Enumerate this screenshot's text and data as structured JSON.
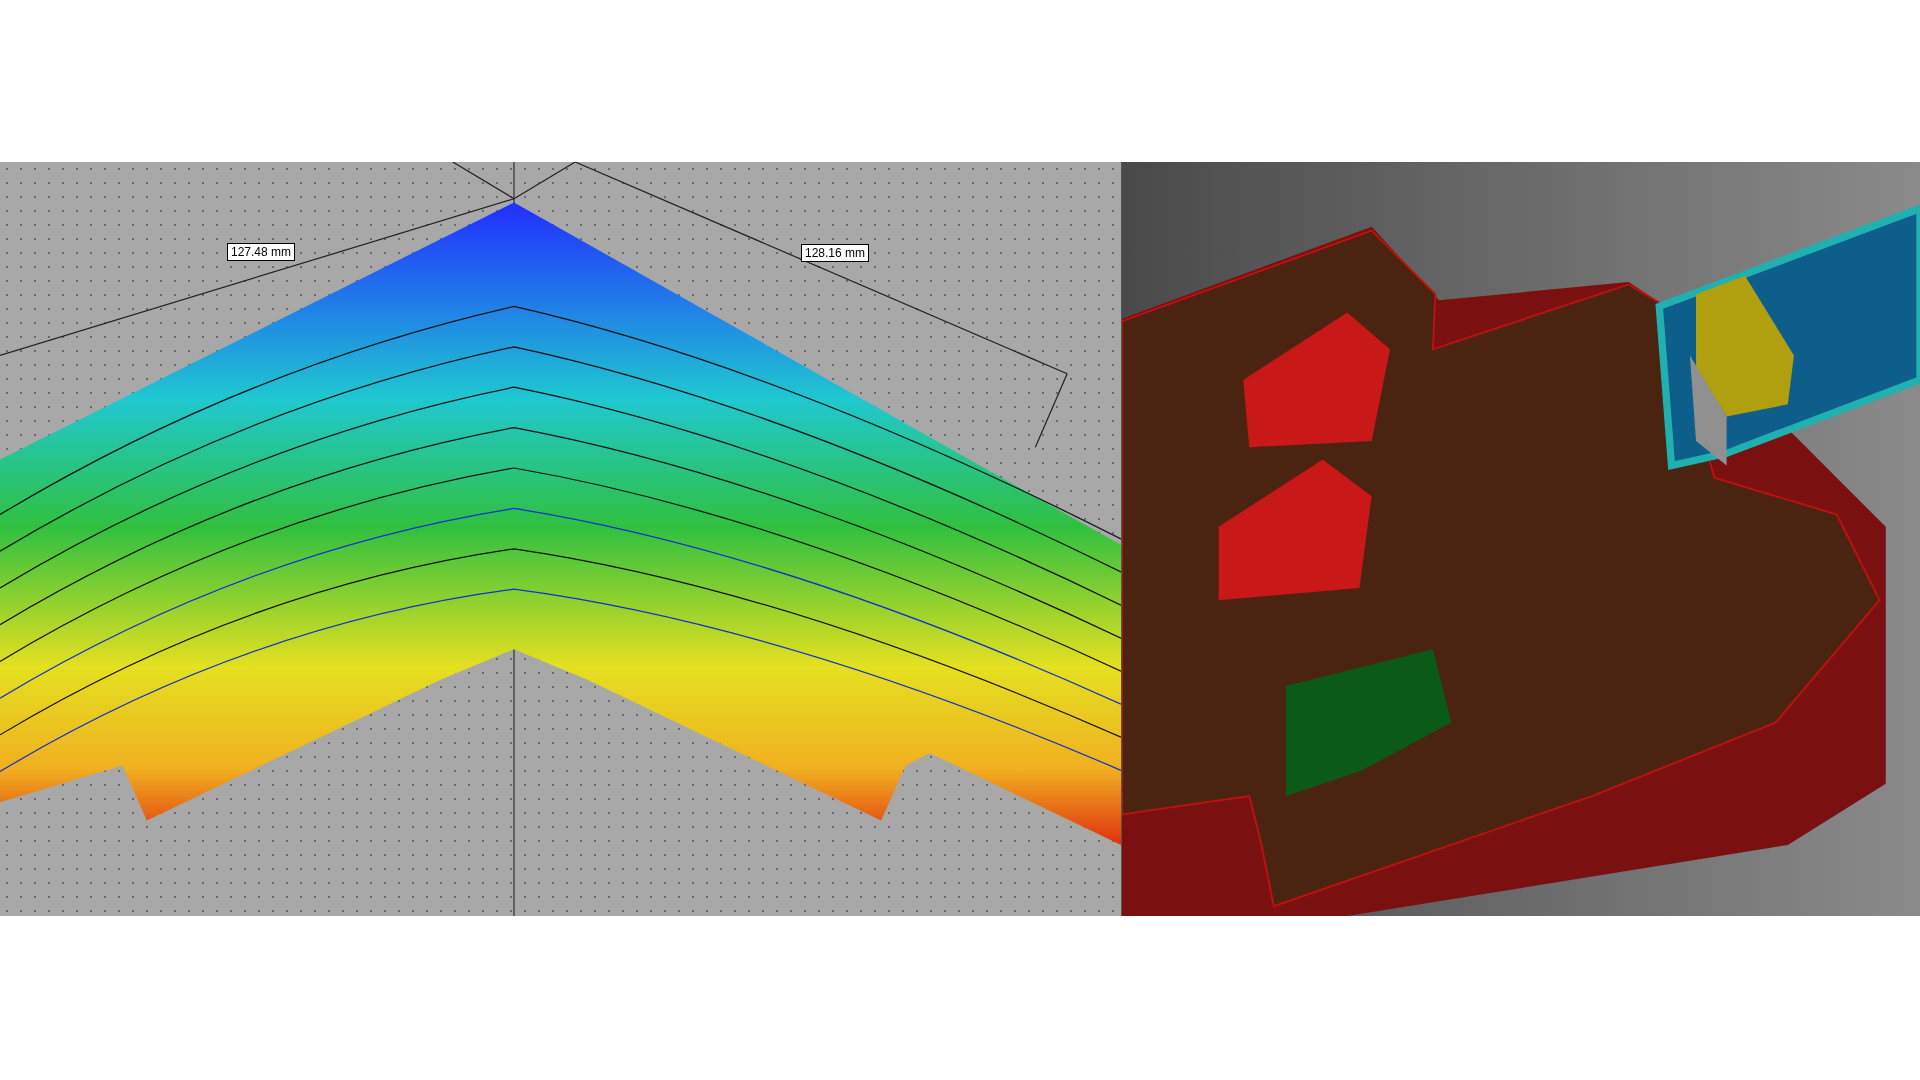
{
  "thermal_view": {
    "dimension_labels": [
      {
        "text": "127.48 mm"
      },
      {
        "text": "128.16 mm"
      }
    ]
  }
}
